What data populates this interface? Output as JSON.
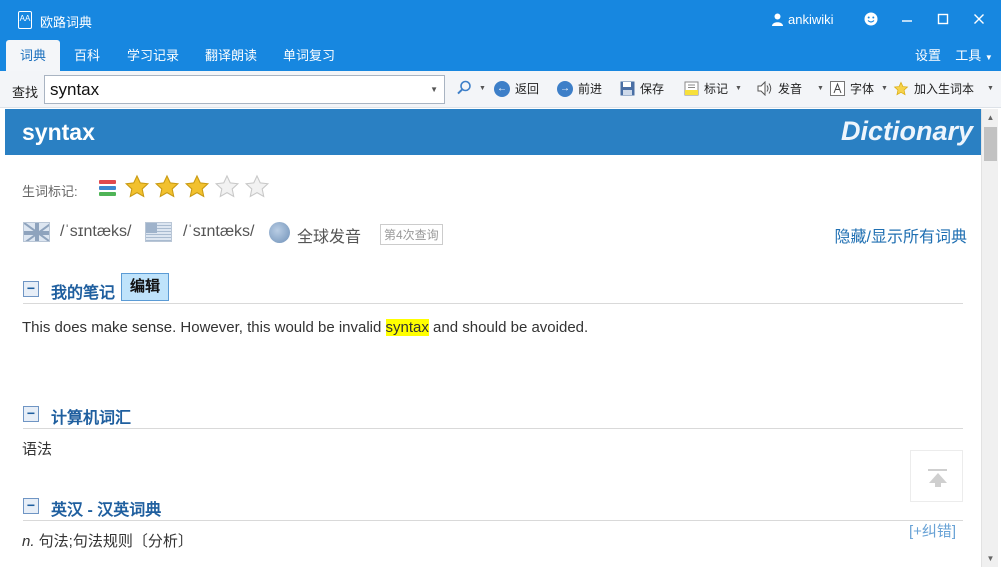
{
  "window": {
    "app_title": "欧路词典",
    "app_icon_text": "AA",
    "user_name": "ankiwiki"
  },
  "tabs": [
    {
      "label": "词典",
      "active": true
    },
    {
      "label": "百科"
    },
    {
      "label": "学习记录"
    },
    {
      "label": "翻译朗读"
    },
    {
      "label": "单词复习"
    }
  ],
  "right_menu": {
    "settings": "设置",
    "tools": "工具"
  },
  "toolbar": {
    "lookup_label": "查找",
    "search_value": "syntax",
    "back": "返回",
    "forward": "前进",
    "save": "保存",
    "mark": "标记",
    "pronounce": "发音",
    "font": "字体",
    "add_wordbook": "加入生词本"
  },
  "entry": {
    "headword": "syntax",
    "brand": "Dictionary",
    "star_label": "生词标记:",
    "stars_filled": 3,
    "stars_total": 5,
    "uk_phonetic": "/ˈsɪntæks/",
    "us_phonetic": "/ˈsɪntæks/",
    "global_pronounce": "全球发音",
    "query_count": "第4次查询",
    "toggle_all": "隐藏/显示所有词典"
  },
  "sections": {
    "notes": {
      "title": "我的笔记",
      "edit_label": "编辑",
      "text_before": "This does make sense. However, this would be invalid ",
      "highlight": "syntax",
      "text_after": " and should be avoided."
    },
    "computer": {
      "title": "计算机词汇",
      "body": "语法"
    },
    "en_cn": {
      "title": "英汉 - 汉英词典",
      "pos": "n.",
      "body": " 句法;句法规则〔分析〕"
    }
  },
  "correct_link": "[+纠错]",
  "colors": {
    "accent": "#1787e0",
    "band": "#2a80c3",
    "link": "#1f6fb2",
    "highlight": "#ffff00",
    "star": "#f2c12e"
  }
}
